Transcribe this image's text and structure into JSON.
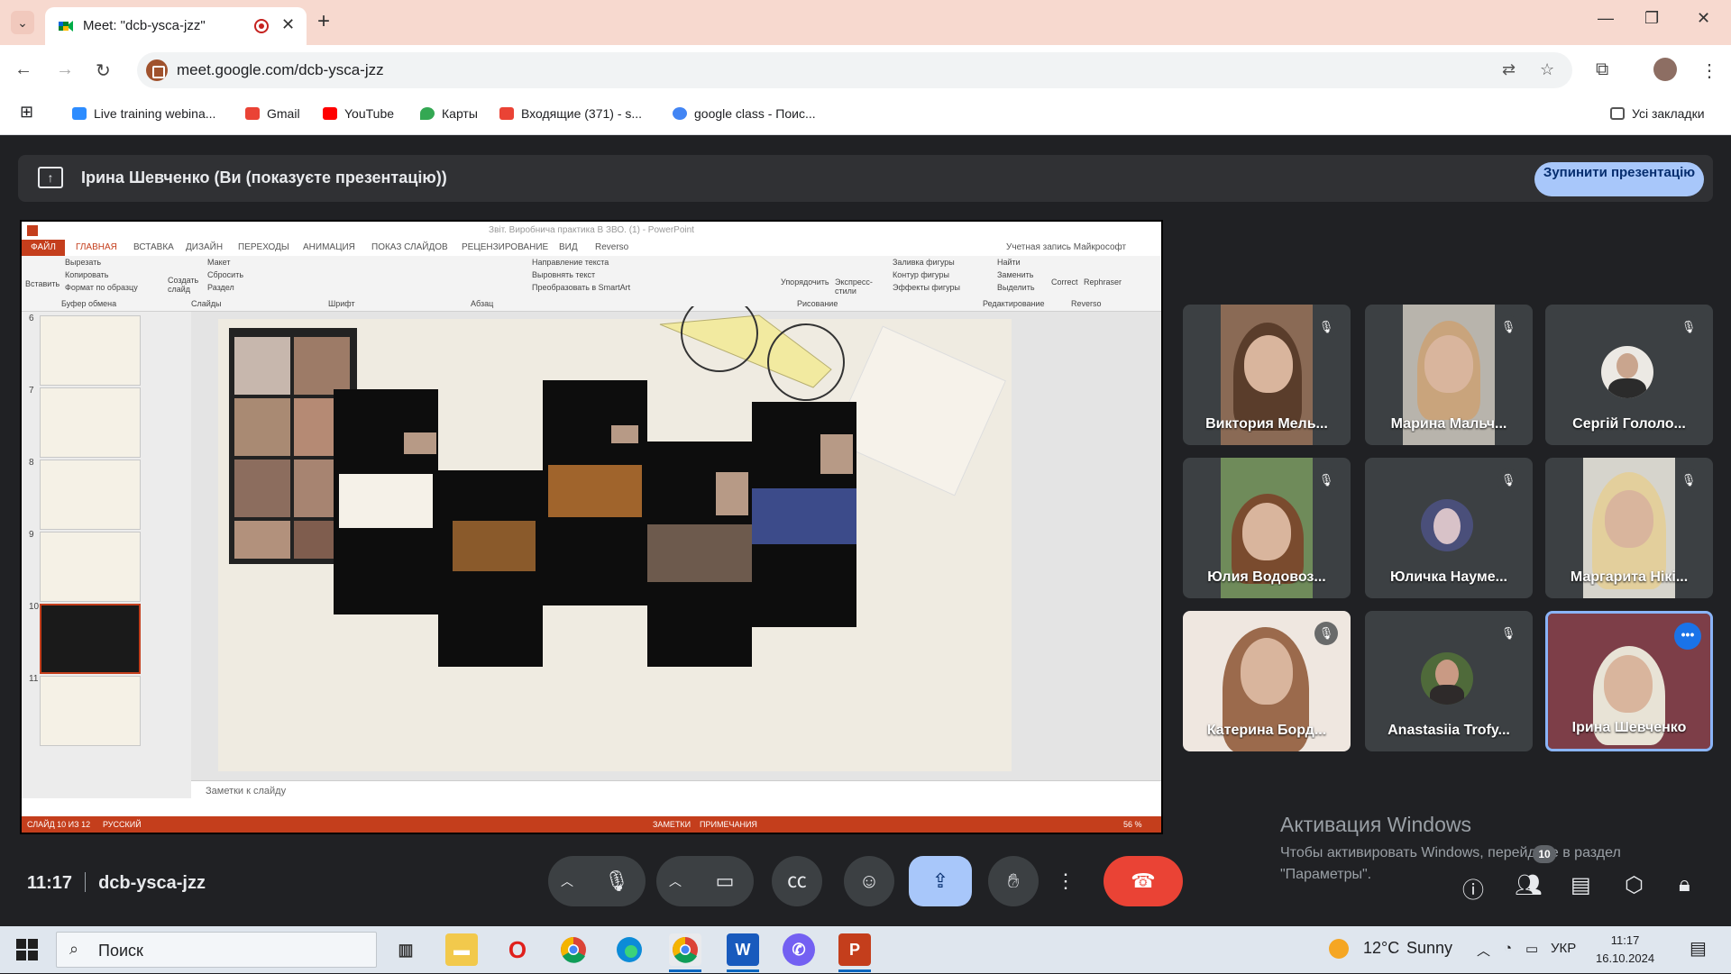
{
  "browser": {
    "tab_title": "Meet: \"dcb-ysca-jzz\"",
    "url": "meet.google.com/dcb-ysca-jzz",
    "bookmarks": [
      {
        "label": "Live training webina...",
        "color": "#2d8cff"
      },
      {
        "label": "Gmail",
        "color": "#ea4335"
      },
      {
        "label": "YouTube",
        "color": "#ff0000"
      },
      {
        "label": "Карты",
        "color": "#34a853"
      },
      {
        "label": "Входящие (371) - s...",
        "color": "#ea4335"
      },
      {
        "label": "google class - Поис...",
        "color": "#4285f4"
      }
    ],
    "all_bookmarks": "Усі закладки"
  },
  "meet": {
    "presenting_text": "Ірина Шевченко (Ви (показуєте презентацію))",
    "stop_presenting": "Зупинити презентацію",
    "time": "11:17",
    "meeting_code": "dcb-ysca-jzz",
    "people_count": "10",
    "participants": [
      {
        "name": "Виктория Мель...",
        "muted": true
      },
      {
        "name": "Марина Мальч...",
        "muted": true
      },
      {
        "name": "Сергій Гололо...",
        "muted": true
      },
      {
        "name": "Юлия Водовоз...",
        "muted": true
      },
      {
        "name": "Юличка Науме...",
        "muted": true
      },
      {
        "name": "Маргарита Нікі...",
        "muted": true
      },
      {
        "name": "Катерина Борд...",
        "muted": true
      },
      {
        "name": "Anastasiia Trofy...",
        "muted": true
      },
      {
        "name": "Ірина Шевченко",
        "muted": false
      }
    ]
  },
  "powerpoint": {
    "window_title": "Звіт. Виробнича практика В ЗВО. (1) - PowerPoint",
    "tabs": [
      "ФАЙЛ",
      "ГЛАВНАЯ",
      "ВСТАВКА",
      "ДИЗАЙН",
      "ПЕРЕХОДЫ",
      "АНИМАЦИЯ",
      "ПОКАЗ СЛАЙДОВ",
      "РЕЦЕНЗИРОВАНИЕ",
      "ВИД",
      "Reverso"
    ],
    "account": "Учетная запись Майкрософт",
    "ribbon": {
      "paste": "Вставить",
      "cut": "Вырезать",
      "copy": "Копировать",
      "format_painter": "Формат по образцу",
      "clipboard": "Буфер обмена",
      "new_slide": "Создать слайд",
      "layout": "Макет",
      "reset": "Сбросить",
      "section": "Раздел",
      "slides": "Слайды",
      "font": "Шрифт",
      "paragraph": "Абзац",
      "text_direction": "Направление текста",
      "align_text": "Выровнять текст",
      "smartart": "Преобразовать в SmartArt",
      "arrange": "Упорядочить",
      "quick_styles": "Экспресс-стили",
      "shape_fill": "Заливка фигуры",
      "shape_outline": "Контур фигуры",
      "shape_effects": "Эффекты фигуры",
      "drawing": "Рисование",
      "find": "Найти",
      "replace": "Заменить",
      "select": "Выделить",
      "editing": "Редактирование",
      "correct": "Correct",
      "rephraser": "Rephraser",
      "reverso": "Reverso"
    },
    "slide_numbers": [
      "6",
      "7",
      "8",
      "9",
      "10",
      "11"
    ],
    "selected_slide": "10",
    "notes_placeholder": "Заметки к слайду",
    "status_left": "СЛАЙД 10 ИЗ 12",
    "status_lang": "РУССКИЙ",
    "status_notes": "ЗАМЕТКИ",
    "status_comments": "ПРИМЕЧАНИЯ",
    "zoom": "56 %"
  },
  "windows": {
    "activation_title": "Активация Windows",
    "activation_text": "Чтобы активировать Windows, перейдите в раздел \"Параметры\".",
    "search_placeholder": "Поиск",
    "weather_temp": "12°C",
    "weather_desc": "Sunny",
    "lang": "УКР",
    "time": "11:17",
    "date": "16.10.2024"
  }
}
